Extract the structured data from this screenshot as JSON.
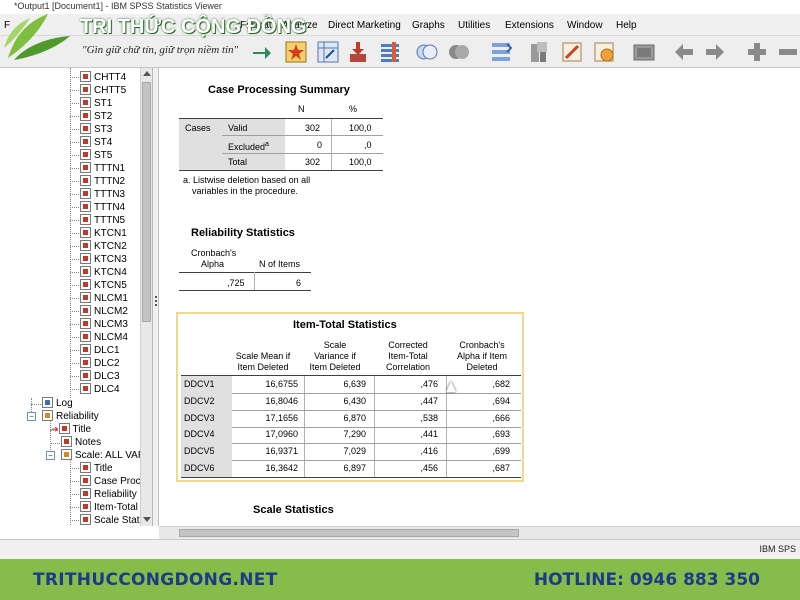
{
  "window": {
    "title": "*Output1 [Document1] - IBM SPSS Statistics Viewer"
  },
  "menu": {
    "items": [
      "Format",
      "Analyze",
      "Direct Marketing",
      "Graphs",
      "Utilities",
      "Extensions",
      "Window",
      "Help"
    ]
  },
  "watermark": {
    "brand": "TRI THỨC CỘNG ĐỒNG",
    "slogan": "\"Gìn giữ chữ tín, giữ trọn niềm tin\""
  },
  "toolbar": {
    "icons": [
      "goto-output-icon",
      "goto-case-icon",
      "import-icon",
      "variables-icon",
      "designate-window-icon",
      "select-cases-icon",
      "weight-cases-icon",
      "split-file-icon",
      "value-labels-icon",
      "use-sets-icon",
      "show-all-icon",
      "promote-icon",
      "back-icon",
      "forward-icon",
      "add-icon",
      "collapse-icon"
    ]
  },
  "tree": {
    "variables": [
      "CHTT4",
      "CHTT5",
      "ST1",
      "ST2",
      "ST3",
      "ST4",
      "ST5",
      "TTTN1",
      "TTTN2",
      "TTTN3",
      "TTTN4",
      "TTTN5",
      "KTCN1",
      "KTCN2",
      "KTCN3",
      "KTCN4",
      "KTCN5",
      "NLCM1",
      "NLCM2",
      "NLCM3",
      "NLCM4",
      "DLC1",
      "DLC2",
      "DLC3",
      "DLC4"
    ],
    "log": "Log",
    "reliability": "Reliability",
    "title": "Title",
    "notes": "Notes",
    "scale": "Scale: ALL VAR",
    "scale_children": [
      "Title",
      "Case Proc",
      "Reliability S",
      "Item-Total",
      "Scale Stati"
    ]
  },
  "case_processing": {
    "title": "Case Processing Summary",
    "col_n": "N",
    "col_pct": "%",
    "group": "Cases",
    "rows": [
      {
        "label": "Valid",
        "n": "302",
        "pct": "100,0"
      },
      {
        "label": "Excluded",
        "sup": "a",
        "n": "0",
        "pct": ",0"
      },
      {
        "label": "Total",
        "n": "302",
        "pct": "100,0"
      }
    ],
    "footnote_1": "a. Listwise deletion based on all",
    "footnote_2": "variables in the procedure."
  },
  "reliability_stats": {
    "title": "Reliability Statistics",
    "col_alpha_1": "Cronbach's",
    "col_alpha_2": "Alpha",
    "col_items": "N of Items",
    "alpha": ",725",
    "items": "6"
  },
  "item_total": {
    "title": "Item-Total Statistics",
    "headers": [
      [
        "",
        "Scale Mean if",
        "Item Deleted"
      ],
      [
        "Scale",
        "Variance if",
        "Item Deleted"
      ],
      [
        "Corrected",
        "Item-Total",
        "Correlation"
      ],
      [
        "Cronbach's",
        "Alpha if Item",
        "Deleted"
      ]
    ],
    "rows": [
      {
        "item": "DDCV1",
        "mean": "16,6755",
        "var": "6,639",
        "corr": ",476",
        "alpha": ",682"
      },
      {
        "item": "DDCV2",
        "mean": "16,8046",
        "var": "6,430",
        "corr": ",447",
        "alpha": ",694"
      },
      {
        "item": "DDCV3",
        "mean": "17,1656",
        "var": "6,870",
        "corr": ",538",
        "alpha": ",666"
      },
      {
        "item": "DDCV4",
        "mean": "17,0960",
        "var": "7,290",
        "corr": ",441",
        "alpha": ",693"
      },
      {
        "item": "DDCV5",
        "mean": "16,9371",
        "var": "7,029",
        "corr": ",416",
        "alpha": ",699"
      },
      {
        "item": "DDCV6",
        "mean": "16,3642",
        "var": "6,897",
        "corr": ",456",
        "alpha": ",687"
      }
    ]
  },
  "scale_stats": {
    "title": "Scale Statistics"
  },
  "status": {
    "text": "IBM SPS"
  },
  "footer": {
    "site": "TRITHUCCONGDONG.NET",
    "hotline": "HOTLINE: 0946 883 350"
  }
}
